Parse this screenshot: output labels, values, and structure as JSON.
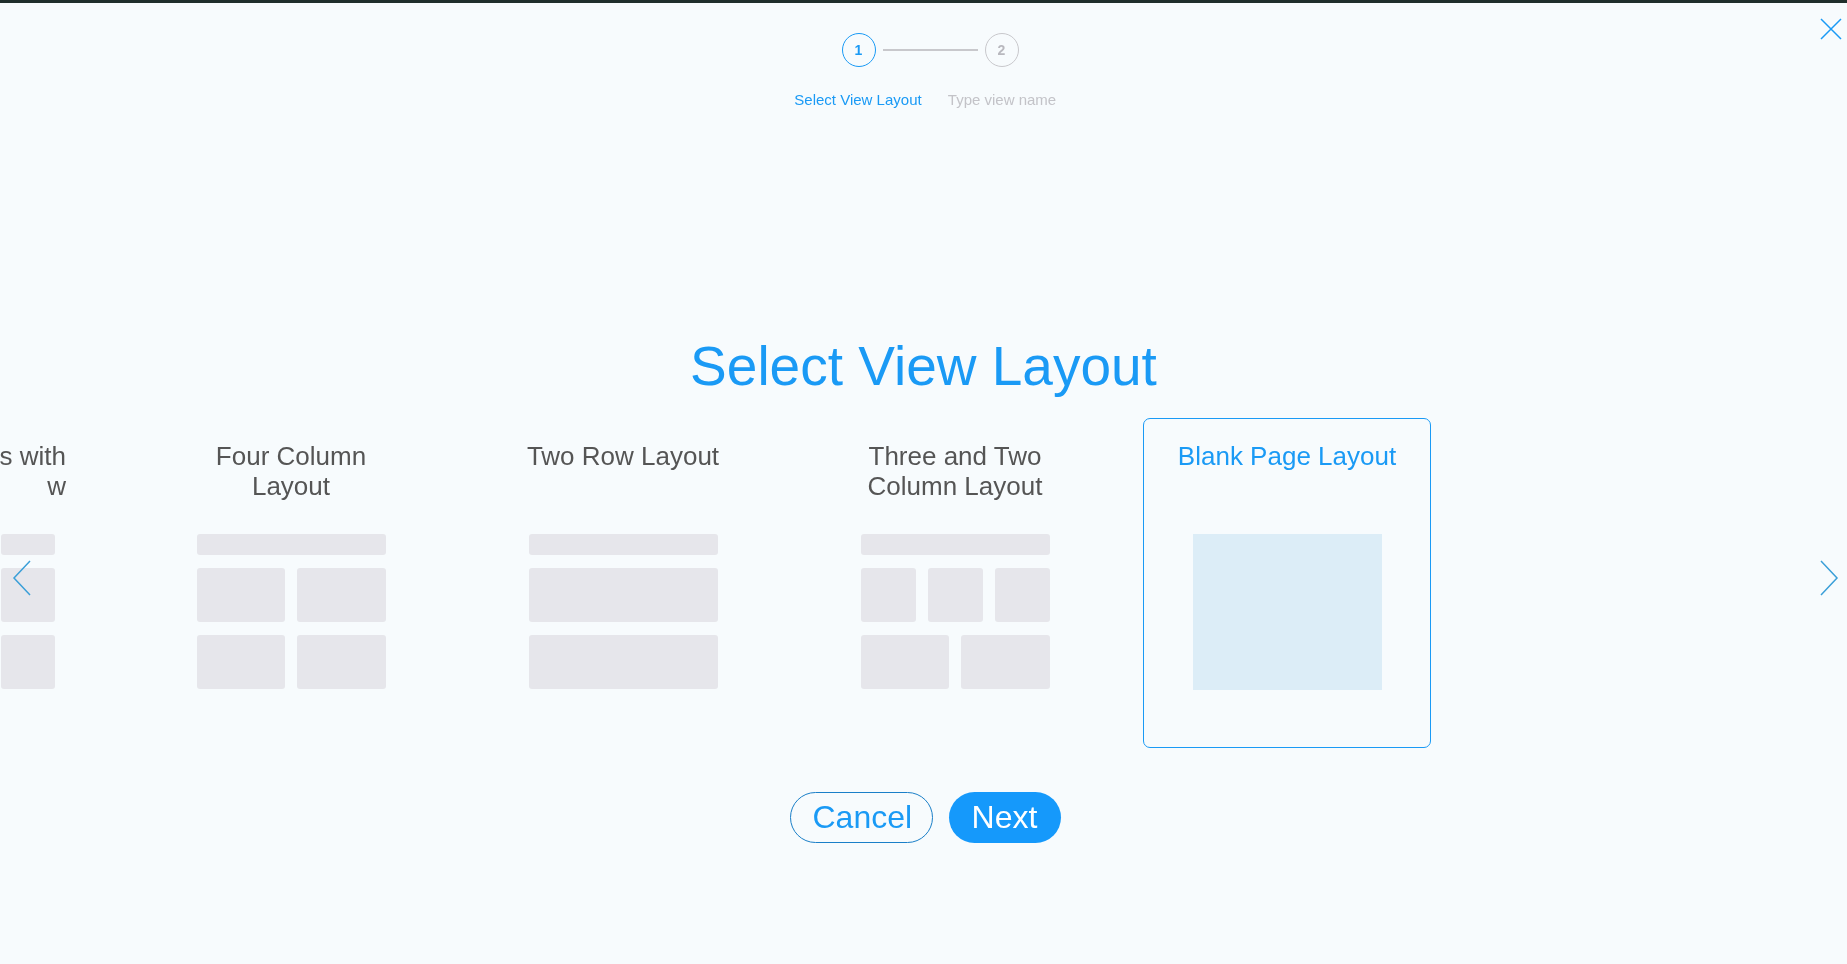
{
  "steps": [
    {
      "number": "1",
      "label": "Select View Layout",
      "selected": true
    },
    {
      "number": "2",
      "label": "Type view name",
      "selected": false
    }
  ],
  "title": "Select View Layout",
  "layouts": [
    {
      "name": "s with\nw",
      "kind": "partial",
      "selected": false
    },
    {
      "name": "Four Column Layout",
      "kind": "four-column",
      "selected": false
    },
    {
      "name": "Two Row Layout",
      "kind": "two-row",
      "selected": false
    },
    {
      "name": "Three and Two Column Layout",
      "kind": "three-two",
      "selected": false
    },
    {
      "name": "Blank Page Layout",
      "kind": "blank",
      "selected": true
    }
  ],
  "buttons": [
    {
      "label": "Cancel",
      "kind": "secondary"
    },
    {
      "label": "Next",
      "kind": "primary"
    }
  ]
}
